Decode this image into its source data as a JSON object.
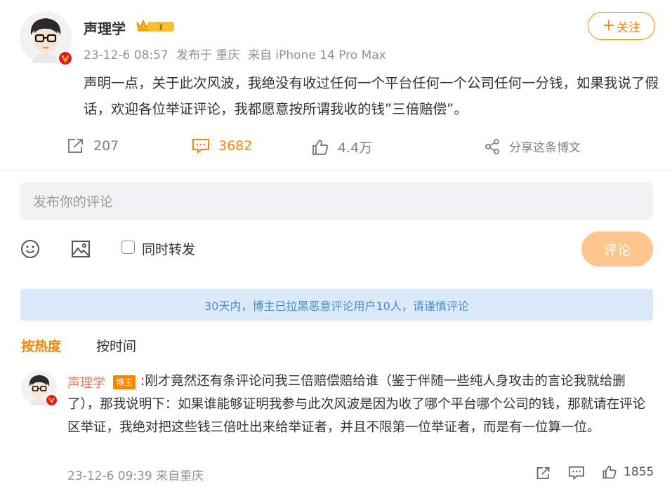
{
  "post": {
    "author": "声理学",
    "level_badge": "I",
    "timestamp": "23-12-6 08:57",
    "location": "发布于 重庆",
    "device": "来自 iPhone 14 Pro Max",
    "follow_label": "关注",
    "follow_plus": "+",
    "text": "声明一点，关于此次风波，我绝没有收过任何一个平台任何一个公司任何一分钱，如果我说了假话，欢迎各位举证评论，我都愿意按所谓我收的钱”三倍赔偿”。",
    "actions": {
      "repost_count": "207",
      "comment_count": "3682",
      "like_count": "4.4万",
      "share_label": "分享这条博文"
    }
  },
  "composer": {
    "placeholder": "发布你的评论",
    "repost_label": "同时转发",
    "submit_label": "评论"
  },
  "notice": "30天内，博主已拉黑恶意评论用户10人，请谨慎评论",
  "sort": {
    "hot": "按热度",
    "time": "按时间"
  },
  "comment": {
    "author": "声理学",
    "tag": "博主",
    "text": ":刚才竟然还有条评论问我三倍赔偿赔给谁（鉴于伴随一些纯人身攻击的言论我就给删了），那我说明下：如果谁能够证明我参与此次风波是因为收了哪个平台哪个公司的钱，那就请在评论区举证，我绝对把这些钱三倍吐出来给举证者，并且不限第一位举证者，而是有一位算一位。",
    "timestamp": "23-12-6 09:39",
    "source": "来自重庆",
    "like_count": "1855"
  },
  "colors": {
    "accent": "#ff8200",
    "notice_bg": "#daeaf9",
    "notice_text": "#4d8bc7",
    "verified_badge": "#e6162d"
  }
}
